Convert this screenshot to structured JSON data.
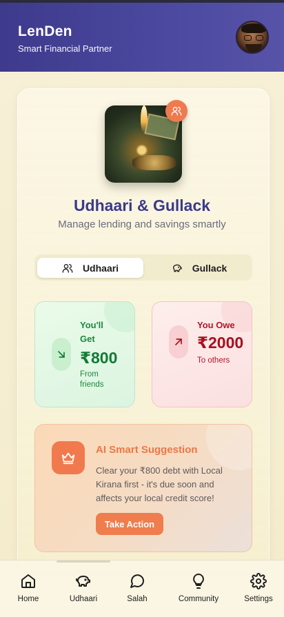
{
  "header": {
    "app_name": "LenDen",
    "subtitle": "Smart Financial Partner"
  },
  "hero": {
    "title": "Udhaari & Gullack",
    "tagline": "Manage lending and savings smartly"
  },
  "tabs": [
    {
      "label": "Udhaari",
      "icon": "users-icon",
      "active": true
    },
    {
      "label": "Gullack",
      "icon": "piggy-bank-icon",
      "active": false
    }
  ],
  "stats": {
    "get": {
      "label": "You'll Get",
      "amount": "₹800",
      "sub": "From friends",
      "color": "#137a34"
    },
    "owe": {
      "label": "You Owe",
      "amount": "₹2000",
      "sub": "To others",
      "color": "#a5101f"
    }
  },
  "ai": {
    "title": "AI Smart Suggestion",
    "text": "Clear your ₹800 debt with Local Kirana first - it's due soon and affects your local credit score!",
    "button": "Take Action",
    "accent": "#f07a4e"
  },
  "nav": [
    {
      "label": "Home",
      "icon": "home-icon"
    },
    {
      "label": "Udhaari",
      "icon": "piggy-bank-icon"
    },
    {
      "label": "Salah",
      "icon": "chat-bubble-icon"
    },
    {
      "label": "Community",
      "icon": "lightbulb-icon"
    },
    {
      "label": "Settings",
      "icon": "gear-icon"
    }
  ]
}
